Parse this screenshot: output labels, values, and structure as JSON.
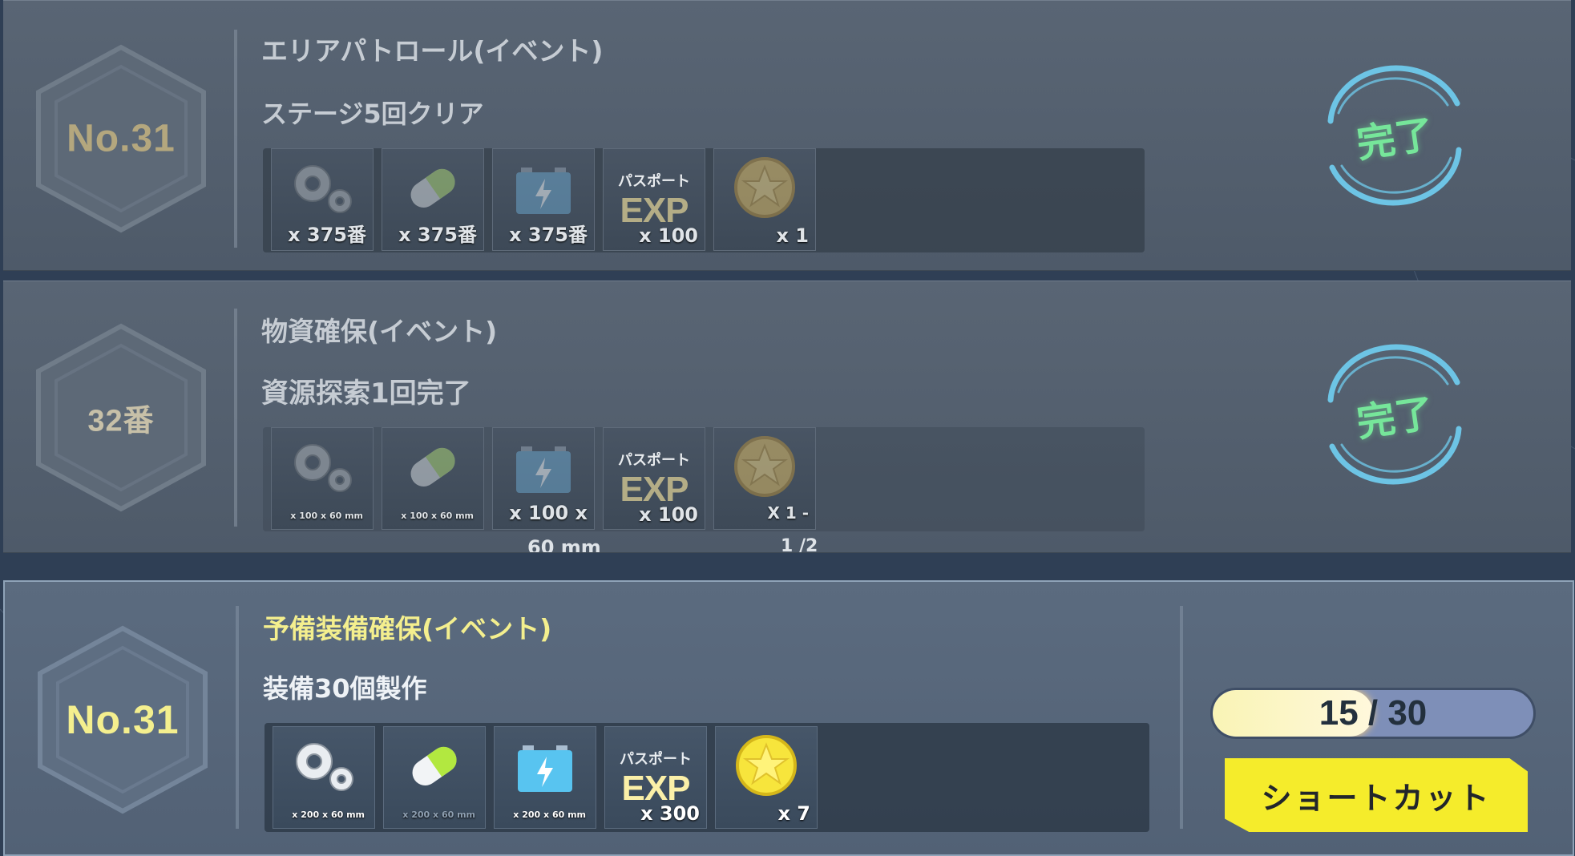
{
  "colors": {
    "complete_stamp": "#5bf08a",
    "active_title": "#f4ef8e",
    "shortcut_button": "#f5ec2b",
    "progress_fill": "#fff8dc",
    "progress_track": "#7e8fb8"
  },
  "missions": [
    {
      "number": "No.31",
      "title": "エリアパトロール(イベント)",
      "objective": "ステージ5回クリア",
      "status": "完了",
      "rewards": [
        {
          "icon": "gear-icon",
          "qty": "x 375番"
        },
        {
          "icon": "capsule-icon",
          "qty": "x 375番"
        },
        {
          "icon": "battery-icon",
          "qty": "x 375番"
        },
        {
          "icon": "passport-exp-icon",
          "top": "パスポート",
          "big": "EXP",
          "qty": "x 100"
        },
        {
          "icon": "star-coin-icon",
          "qty": "x 1"
        }
      ]
    },
    {
      "number": "32番",
      "title": "物資確保(イベント)",
      "objective": "資源探索1回完了",
      "status": "完了",
      "rewards": [
        {
          "icon": "gear-icon",
          "qty": "x 100 x 60 mm"
        },
        {
          "icon": "capsule-icon",
          "qty": "x 100 x 60 mm"
        },
        {
          "icon": "battery-icon",
          "qty": "x 100 x",
          "below": "60 mm"
        },
        {
          "icon": "passport-exp-icon",
          "top": "パスポート",
          "big": "EXP",
          "qty": "x 100"
        },
        {
          "icon": "star-coin-icon",
          "qty": "X 1 -",
          "below": "1 /2"
        }
      ]
    },
    {
      "number": "No.31",
      "title": "予備装備確保(イベント)",
      "objective": "装備30個製作",
      "progress": {
        "current": 15,
        "total": 30,
        "label": "15 / 30"
      },
      "action": "ショートカット",
      "rewards": [
        {
          "icon": "gear-icon",
          "qty": "x 200 x 60 mm"
        },
        {
          "icon": "capsule-icon",
          "qty": "x 200 x 60 mm"
        },
        {
          "icon": "battery-icon",
          "qty": "x 200 x 60 mm"
        },
        {
          "icon": "passport-exp-icon",
          "top": "パスポート",
          "big": "EXP",
          "qty": "x 300"
        },
        {
          "icon": "star-coin-icon",
          "qty": "x 7"
        }
      ]
    }
  ]
}
